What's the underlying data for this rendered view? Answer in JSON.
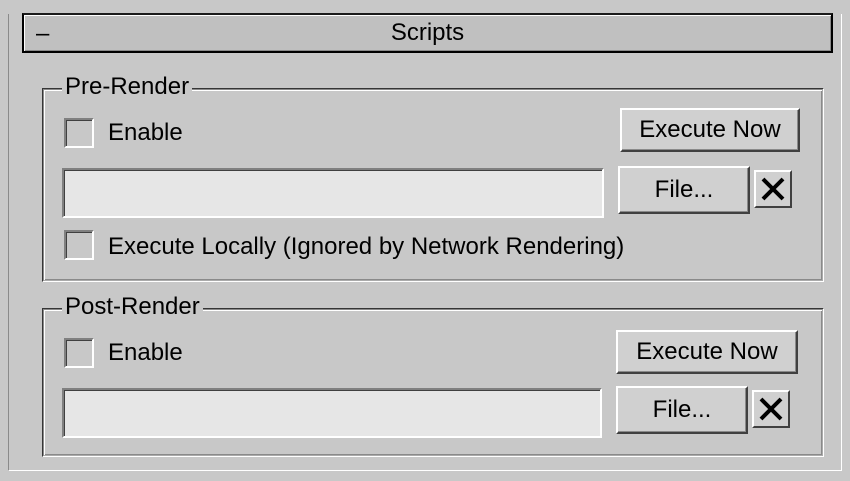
{
  "rollout": {
    "collapse_glyph": "–",
    "title": "Scripts"
  },
  "pre_render": {
    "legend": "Pre-Render",
    "enable_label": "Enable",
    "enable_checked": false,
    "execute_now_label": "Execute Now",
    "script_path": "",
    "file_button_label": "File...",
    "clear_icon": "x-icon",
    "execute_locally_label": "Execute Locally (Ignored by Network Rendering)",
    "execute_locally_checked": false
  },
  "post_render": {
    "legend": "Post-Render",
    "enable_label": "Enable",
    "enable_checked": false,
    "execute_now_label": "Execute Now",
    "script_path": "",
    "file_button_label": "File...",
    "clear_icon": "x-icon"
  }
}
